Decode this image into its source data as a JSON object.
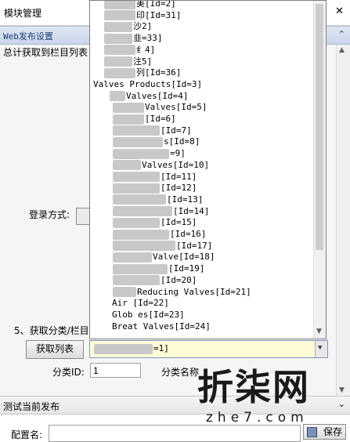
{
  "window": {
    "title": "模块管理",
    "close_glyph": "✕"
  },
  "web_section": {
    "title": "Web发布设置",
    "chevron": "⌃"
  },
  "info_text": "总计获取到栏目列表",
  "login": {
    "label": "登录方式:"
  },
  "step5": {
    "label": "5、获取分类/栏目"
  },
  "fetch_button": "获取列表",
  "combo": {
    "value": "=1]"
  },
  "category_id": {
    "label": "分类ID:",
    "value": "1"
  },
  "category_name": {
    "label": "分类名称"
  },
  "test_section": {
    "title": "测试当前发布",
    "chevron": "⌄"
  },
  "config": {
    "label": "配置名:"
  },
  "save_button": "保存",
  "dropdown": {
    "items": [
      "美[Id=2]",
      "印[Id=31]",
      "沙2]",
      "韭=33]",
      "纟4]",
      "注5]",
      "列[Id=36]",
      "Valves Products[Id=3]",
      "Valves[Id=4]",
      "Valves[Id=5]",
      "[Id=6]",
      "[Id=7]",
      "s[Id=8]",
      "=9]",
      "Valves[Id=10]",
      "[Id=11]",
      "[Id=12]",
      "[Id=13]",
      "[Id=14]",
      "[Id=15]",
      "[Id=16]",
      "[Id=17]",
      "Valve[Id=18]",
      "[Id=19]",
      "[Id=20]",
      "Reducing Valves[Id=21]",
      "Air [Id=22]",
      "Glob es[Id=23]",
      "Breat Valves[Id=24]"
    ]
  },
  "watermark": {
    "logo": "折柒网",
    "url": "zhe7.com"
  },
  "colors": {
    "header_bg": "#c9d6ea",
    "combo_bg": "#fffbd6",
    "selected_bg": "#fff2a0"
  }
}
